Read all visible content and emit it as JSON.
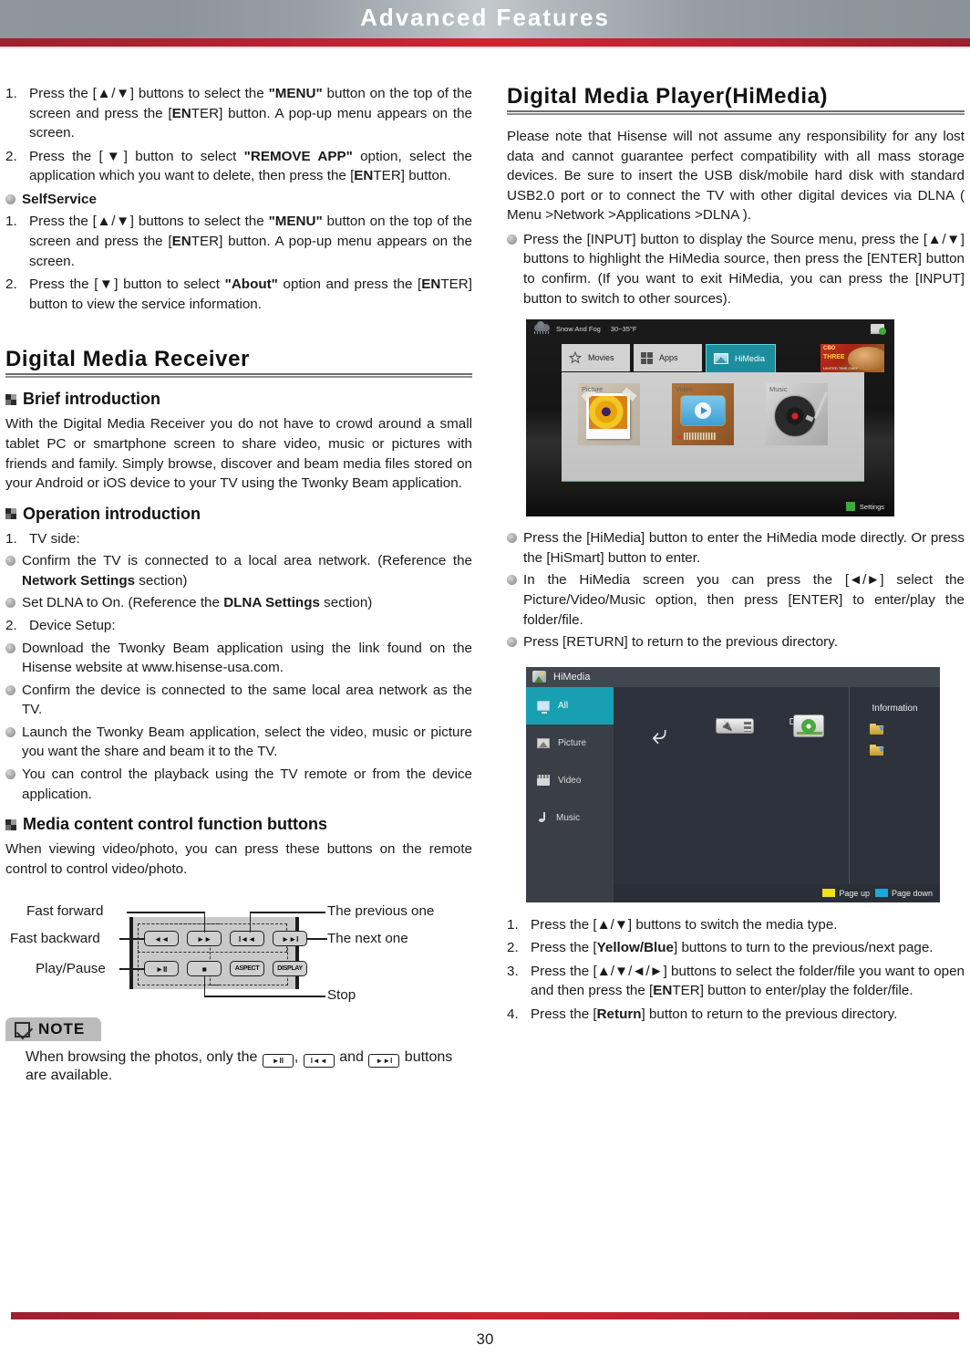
{
  "header": {
    "title": "Advanced Features"
  },
  "footer": {
    "page_number": "30"
  },
  "left": {
    "remove_app_steps": [
      {
        "n": "1.",
        "html": "Press the [▲/▼] buttons to select the <b>\"MENU\"</b> button on the top of the screen and press the [<b>EN</b>TER] button. A pop-up menu appears on the screen."
      },
      {
        "n": "2.",
        "html": "Press the [▼] button to select <b>\"REMOVE APP\"</b> option, select the application which you want to delete, then press the [<b>EN</b>TER] button."
      }
    ],
    "selfservice_heading": "SelfService",
    "selfservice_steps": [
      {
        "n": "1.",
        "html": "Press the [▲/▼] buttons to select the <b>\"MENU\"</b> button on the top of the screen and press the [<b>EN</b>TER] button. A pop-up menu appears on the screen."
      },
      {
        "n": "2.",
        "html": "Press the [▼] button to select <b>\"About\"</b> option and press the [<b>EN</b>TER] button to view the service information."
      }
    ],
    "section_title": "Digital Media Receiver",
    "brief_intro_heading": "Brief introduction",
    "brief_intro_body": "With the Digital Media Receiver you do not have to crowd around a small tablet PC or smartphone screen to share video, music or pictures with friends and family.  Simply browse, discover and beam media files stored on your Android or iOS device to your TV using the Twonky Beam application.",
    "operation_heading": "Operation introduction",
    "operation_items": [
      {
        "kind": "num",
        "n": "1.",
        "html": "TV side:"
      },
      {
        "kind": "dot",
        "html": "Confirm the TV is connected to a local area network. (Reference the <b>Network Settings</b> section)"
      },
      {
        "kind": "dot",
        "html": "Set DLNA to On. (Reference the <b>DLNA Settings</b> section)"
      },
      {
        "kind": "num",
        "n": "2.",
        "html": "Device Setup:"
      },
      {
        "kind": "dot",
        "html": "Download the Twonky Beam application using the link found on the Hisense website at www.hisense-usa.com."
      },
      {
        "kind": "dot",
        "html": "Confirm the device is connected to the same local area network as the TV."
      },
      {
        "kind": "dot",
        "html": "Launch the Twonky Beam application, select the video, music or picture you want the share and beam it to the TV."
      },
      {
        "kind": "dot",
        "html": "You can control the playback using the TV remote or from the device application."
      }
    ],
    "media_buttons_heading": "Media content control function buttons",
    "media_buttons_body": "When viewing video/photo, you can press these buttons on the remote control to control video/photo.",
    "remote": {
      "labels": {
        "fast_forward": "Fast forward",
        "fast_backward": "Fast backward",
        "play_pause": "Play/Pause",
        "previous": "The previous one",
        "next": "The next one",
        "stop": "Stop"
      },
      "buttons": {
        "rew": "◄◄",
        "ff": "►►",
        "prev": "I◄◄",
        "next": "►►I",
        "playpause": "►II",
        "stop": "■",
        "aspect": "ASPECT",
        "display": "DISPLAY"
      }
    },
    "note": {
      "title": "NOTE",
      "text_before": "When browsing the photos, only the",
      "btn1": "►II",
      "sep1": ",",
      "btn2": "I◄◄",
      "sep2": "and",
      "btn3": "►►I",
      "text_after": "buttons are available."
    }
  },
  "right": {
    "section_title": "Digital Media Player(HiMedia)",
    "intro": "Please note that Hisense will not assume any responsibility for any lost data and cannot guarantee perfect compatibility with all mass storage devices. Be sure to insert the USB disk/mobile hard disk with standard USB2.0 port or to connect the TV with other digital devices via DLNA ( Menu >Network >Applications >DLNA ).",
    "bullets_top": [
      "Press the [INPUT] button to display the Source menu, press the [▲/▼] buttons to highlight the HiMedia source, then press the [ENTER] button to confirm. (If you want to exit HiMedia, you can press the [INPUT] button to switch to other sources)."
    ],
    "bullets_mid": [
      "Press the [HiMedia] button to enter the HiMedia mode directly. Or press the [HiSmart] button to enter.",
      "In the HiMedia screen you can press the [◄/►] select the Picture/Video/Music option, then press [ENTER] to enter/play the folder/file.",
      "Press [RETURN] to return to the previous directory."
    ],
    "steps_bottom": [
      {
        "n": "1.",
        "html": "Press the [▲/▼] buttons to switch the media type."
      },
      {
        "n": "2.",
        "html": "Press the [<b>Yellow/Blue</b>] buttons to turn to the previous/next page."
      },
      {
        "n": "3.",
        "html": "Press the [▲/▼/◄/►] buttons to select the folder/file you want to open and then press the [<b>EN</b>TER] button to enter/play the folder/file."
      },
      {
        "n": "4.",
        "html": "Press the [<b>Return</b>] button to return to the previous directory."
      }
    ],
    "tv_home": {
      "weather": "Snow And Fog",
      "temperature": "30~35°F",
      "tabs": [
        "Movies",
        "Apps",
        "HiMedia"
      ],
      "active_tab": "HiMedia",
      "tiles": [
        "Picture",
        "Video",
        "Music"
      ],
      "settings_label": "Settings",
      "ad": {
        "line1": "CBO",
        "line2": "THREE",
        "line3": "LIMITED TIME ONLY"
      }
    },
    "tv_browser": {
      "title": "HiMedia",
      "sidebar": [
        "All",
        "Picture",
        "Video",
        "Music"
      ],
      "active_sidebar": "All",
      "devices": [
        "USB1",
        "DLNA"
      ],
      "information_label": "Information",
      "page_up": "Page up",
      "page_down": "Page down"
    }
  },
  "colors": {
    "accent_red": "#bb2332",
    "header_gray": "#909a9f",
    "tv_teal": "#18a0b2",
    "green": "#3faa3c",
    "yellow": "#f2df1e",
    "blue": "#19a8dd"
  }
}
